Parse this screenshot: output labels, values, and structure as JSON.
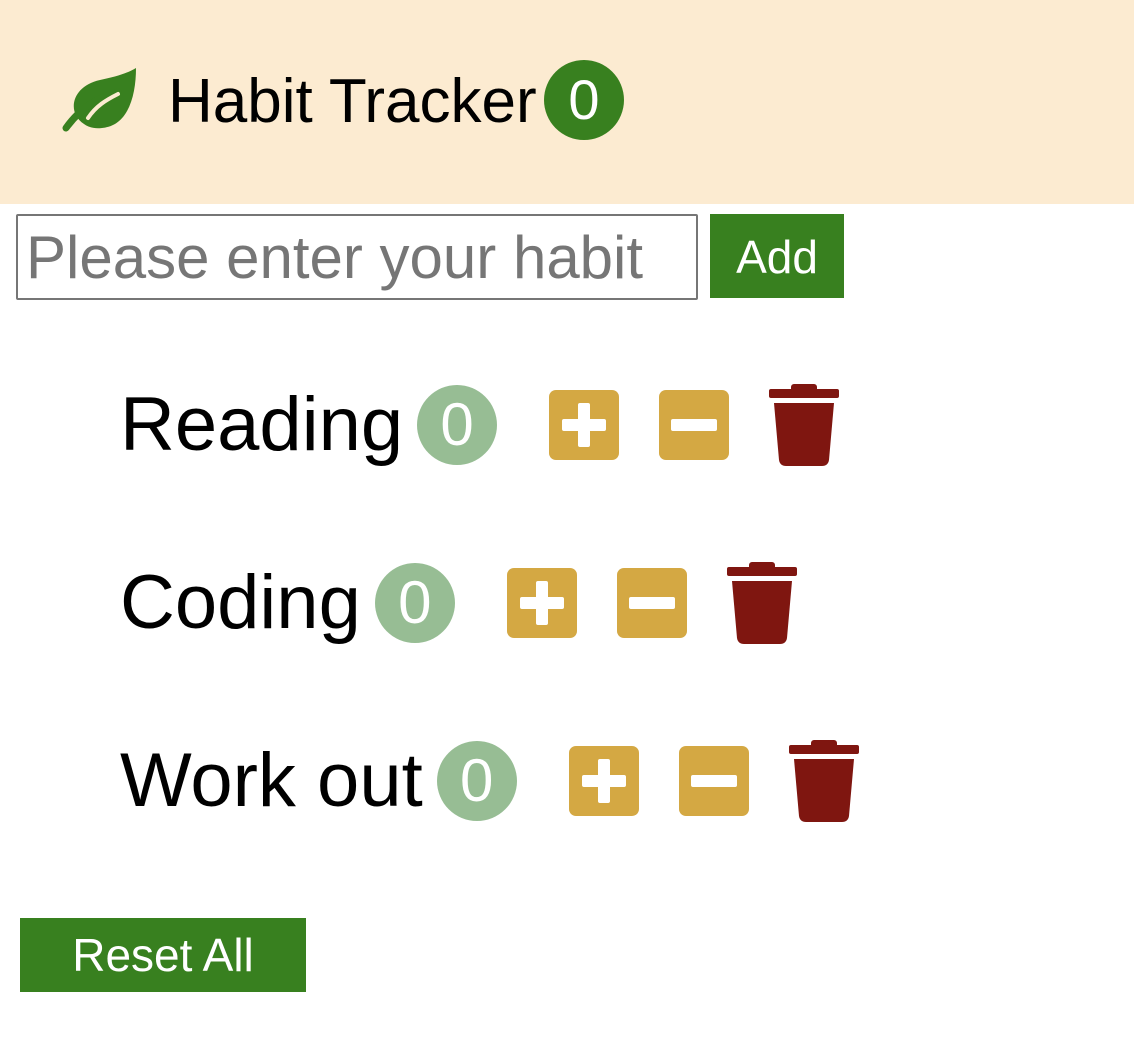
{
  "navbar": {
    "logo_icon": "leaf-icon",
    "title": "Habit Tracker",
    "total_count": "0"
  },
  "add_form": {
    "placeholder": "Please enter your habit",
    "value": "",
    "add_label": "Add"
  },
  "habits": [
    {
      "name": "Reading",
      "count": "0"
    },
    {
      "name": "Coding",
      "count": "0"
    },
    {
      "name": "Work out",
      "count": "0"
    }
  ],
  "icons": {
    "increase": "plus-square-icon",
    "decrease": "minus-square-icon",
    "delete": "trash-icon"
  },
  "reset_label": "Reset All",
  "colors": {
    "navbar_bg": "#fcebd1",
    "brand_green": "#38801f",
    "count_badge": "#97bd94",
    "action_gold": "#d4a843",
    "delete_red": "#7f1610"
  }
}
